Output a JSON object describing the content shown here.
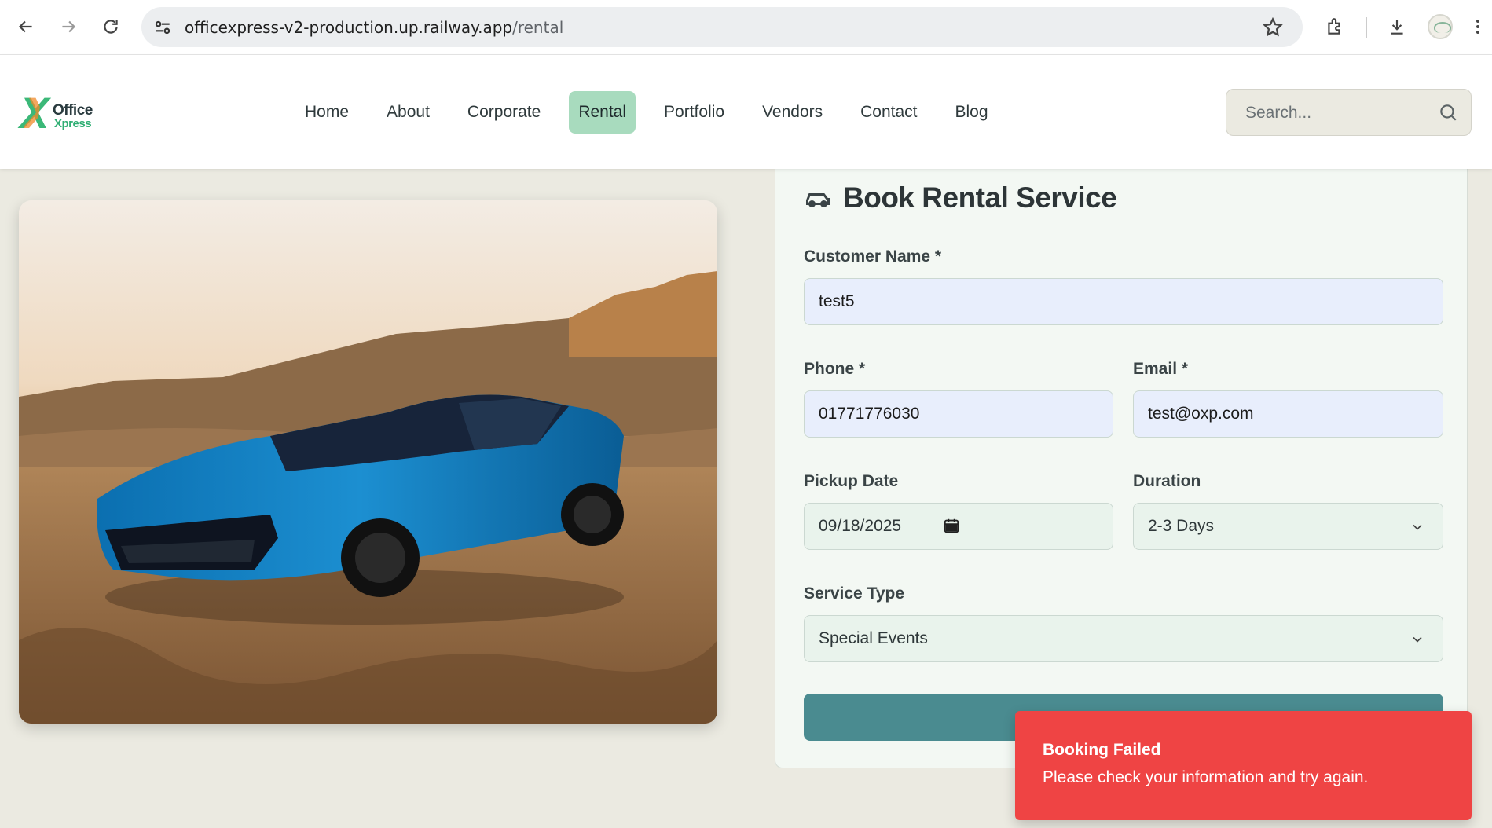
{
  "browser": {
    "url_host": "officexpress-v2-production.up.railway.app",
    "url_path": "/rental"
  },
  "site": {
    "logo_top": "Office",
    "logo_bottom": "Xpress",
    "nav": [
      "Home",
      "About",
      "Corporate",
      "Rental",
      "Portfolio",
      "Vendors",
      "Contact",
      "Blog"
    ],
    "active_nav": "Rental",
    "search_placeholder": "Search..."
  },
  "form": {
    "title": "Book Rental Service",
    "customer_name_label": "Customer Name *",
    "customer_name_value": "test5",
    "phone_label": "Phone *",
    "phone_value": "01771776030",
    "email_label": "Email *",
    "email_value": "test@oxp.com",
    "pickup_label": "Pickup Date",
    "pickup_value": "09/18/2025",
    "duration_label": "Duration",
    "duration_value": "2-3 Days",
    "service_label": "Service Type",
    "service_value": "Special Events"
  },
  "toast": {
    "title": "Booking Failed",
    "message": "Please check your information and try again."
  },
  "colors": {
    "page_bg": "#ebeae1",
    "active_nav_bg": "#a8dbbe",
    "submit_bg": "#4a8b90",
    "toast_bg": "#ef4444"
  }
}
